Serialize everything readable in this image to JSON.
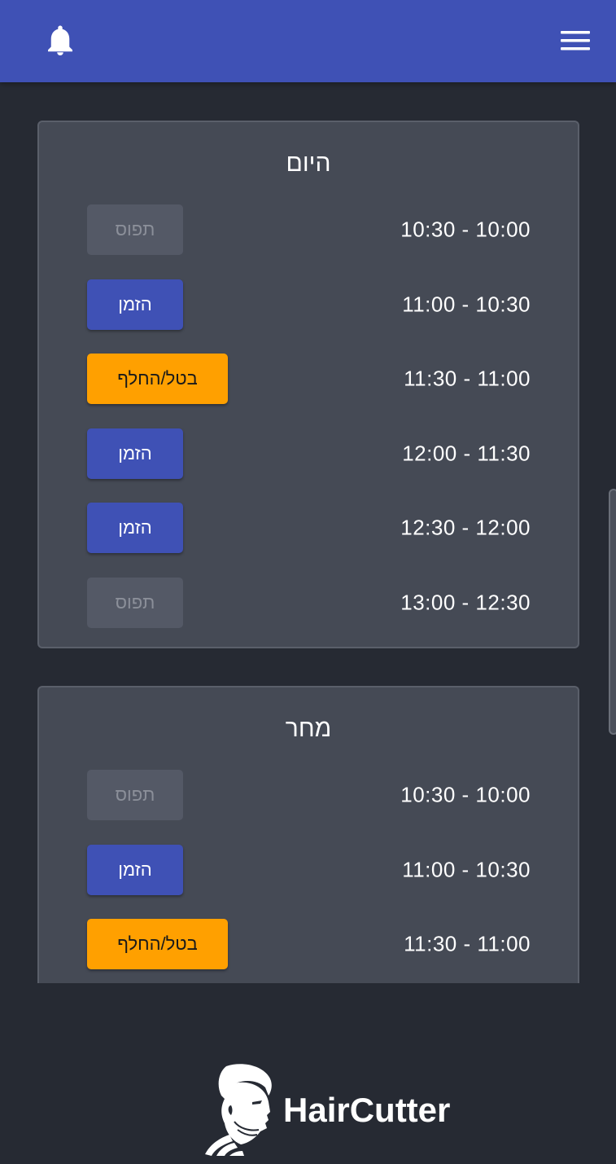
{
  "header": {
    "bell_icon": "bell-icon",
    "menu_icon": "hamburger-menu-icon",
    "color": "#3f51b5"
  },
  "days": [
    {
      "title": "היום",
      "slots": [
        {
          "time": "10:30 - 10:00",
          "action": "תפוס",
          "state": "busy"
        },
        {
          "time": "11:00 - 10:30",
          "action": "הזמן",
          "state": "available"
        },
        {
          "time": "11:30 - 11:00",
          "action": "בטל/החלף",
          "state": "mine"
        },
        {
          "time": "12:00 - 11:30",
          "action": "הזמן",
          "state": "available"
        },
        {
          "time": "12:30 - 12:00",
          "action": "הזמן",
          "state": "available"
        },
        {
          "time": "13:00 - 12:30",
          "action": "תפוס",
          "state": "busy"
        }
      ]
    },
    {
      "title": "מחר",
      "slots": [
        {
          "time": "10:30 - 10:00",
          "action": "תפוס",
          "state": "busy"
        },
        {
          "time": "11:00 - 10:30",
          "action": "הזמן",
          "state": "available"
        },
        {
          "time": "11:30 - 11:00",
          "action": "בטל/החלף",
          "state": "mine"
        }
      ]
    }
  ],
  "footer": {
    "brand": "HairCutter",
    "logo_icon": "bearded-man-logo-icon"
  },
  "colors": {
    "background": "#262a33",
    "card": "#454a55",
    "book": "#3f51b5",
    "cancel": "#ffa000",
    "busy": "#545966"
  }
}
